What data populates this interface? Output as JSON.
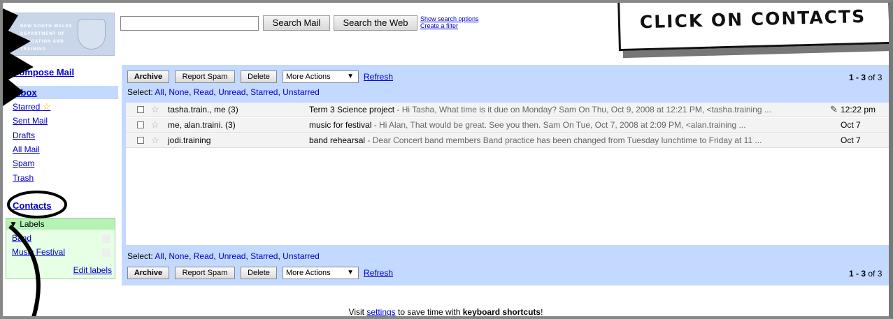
{
  "logo": {
    "text": "NEW SOUTH WALES DEPARTMENT OF EDUCATION AND TRAINING"
  },
  "search": {
    "input_value": "",
    "search_mail": "Search Mail",
    "search_web": "Search the Web",
    "show_options": "Show search options",
    "create_filter": "Create a filter"
  },
  "nav": {
    "compose": "Compose Mail",
    "inbox": "Inbox",
    "starred": "Starred",
    "sent": "Sent Mail",
    "drafts": "Drafts",
    "all": "All Mail",
    "spam": "Spam",
    "trash": "Trash",
    "contacts": "Contacts"
  },
  "labels": {
    "header": "▼ Labels",
    "items": [
      "Band",
      "Music Festival"
    ],
    "edit": "Edit labels"
  },
  "toolbar": {
    "archive": "Archive",
    "report_spam": "Report Spam",
    "delete": "Delete",
    "more_actions": "More Actions",
    "refresh": "Refresh",
    "count_range": "1 - 3",
    "count_of": " of 3"
  },
  "select_bar": {
    "prefix": "Select: ",
    "all": "All",
    "none": "None",
    "read": "Read",
    "unread": "Unread",
    "starred": "Starred",
    "unstarred": "Unstarred"
  },
  "messages": [
    {
      "sender": "tasha.train., me (3)",
      "subject": "Term 3 Science project",
      "snippet": " - Hi Tasha, What time is it due on Monday? Sam On Thu, Oct 9, 2008 at 12:21 PM, <tasha.training ...",
      "date": "12:22 pm",
      "attachment": true
    },
    {
      "sender": "me, alan.traini. (3)",
      "subject": "music for festival",
      "snippet": " - Hi Alan, That would be great. See you then. Sam On Tue, Oct 7, 2008 at 2:09 PM, <alan.training ...",
      "date": "Oct 7",
      "attachment": false
    },
    {
      "sender": "jodi.training",
      "subject": "band rehearsal",
      "snippet": " - Dear Concert band members Band practice has been changed from Tuesday lunchtime to Friday at 11 ...",
      "date": "Oct 7",
      "attachment": false
    }
  ],
  "footer": {
    "pre": "Visit ",
    "link": "settings",
    "mid": " to save time with ",
    "bold": "keyboard shortcuts",
    "post": "!"
  },
  "overlay": {
    "callout": "CLICK ON CONTACTS"
  },
  "colors": {
    "panel": "#c3d9ff",
    "labels_bg": "#e7ffe4",
    "link": "#0000cc"
  }
}
